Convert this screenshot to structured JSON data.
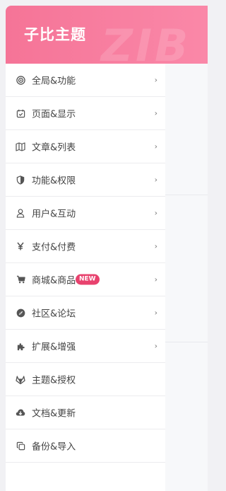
{
  "header": {
    "title": "子比主题",
    "watermark": "ZIB"
  },
  "nav": {
    "items": [
      {
        "label": "全局&功能",
        "icon": "target-icon",
        "chevron": true
      },
      {
        "label": "页面&显示",
        "icon": "calendar-check-icon",
        "chevron": true
      },
      {
        "label": "文章&列表",
        "icon": "map-icon",
        "chevron": true
      },
      {
        "label": "功能&权限",
        "icon": "shield-icon",
        "chevron": true
      },
      {
        "label": "用户&互动",
        "icon": "user-icon",
        "chevron": true
      },
      {
        "label": "支付&付费",
        "icon": "yen-icon",
        "chevron": true
      },
      {
        "label": "商城&商品",
        "icon": "cart-icon",
        "chevron": true,
        "badge": "NEW"
      },
      {
        "label": "社区&论坛",
        "icon": "compass-icon",
        "chevron": true
      },
      {
        "label": "扩展&增强",
        "icon": "puzzle-icon",
        "chevron": true
      },
      {
        "label": "主题&授权",
        "icon": "gitlab-icon",
        "chevron": false
      },
      {
        "label": "文档&更新",
        "icon": "cloud-download-icon",
        "chevron": false
      },
      {
        "label": "备份&导入",
        "icon": "copy-icon",
        "chevron": false
      }
    ],
    "chevron_glyph": "›"
  },
  "colors": {
    "header_start": "#f57497",
    "header_end": "#fa88a8",
    "badge": "#e8426e"
  }
}
